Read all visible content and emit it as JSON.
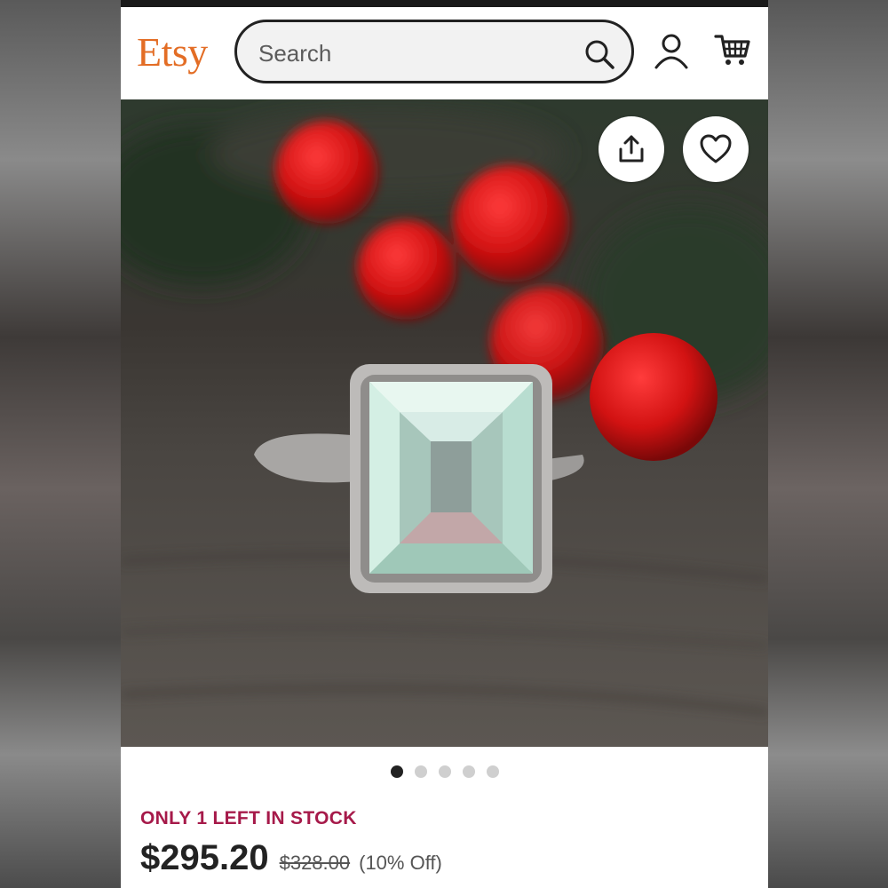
{
  "header": {
    "logo_text": "Etsy",
    "search_placeholder": "Search",
    "search_icon": "search-icon",
    "account_icon": "account-icon",
    "cart_icon": "cart-icon"
  },
  "gallery": {
    "share_icon": "share-icon",
    "favorite_icon": "heart-icon",
    "image_count": 5,
    "active_index": 0
  },
  "product": {
    "stock_notice": "ONLY 1 LEFT IN STOCK",
    "price": "$295.20",
    "original_price": "$328.00",
    "discount": "(10% Off)"
  },
  "colors": {
    "brand": "#e36d25",
    "stock_notice": "#a61a4a",
    "active_dot": "#222222",
    "inactive_dot": "#cfcfcf"
  }
}
